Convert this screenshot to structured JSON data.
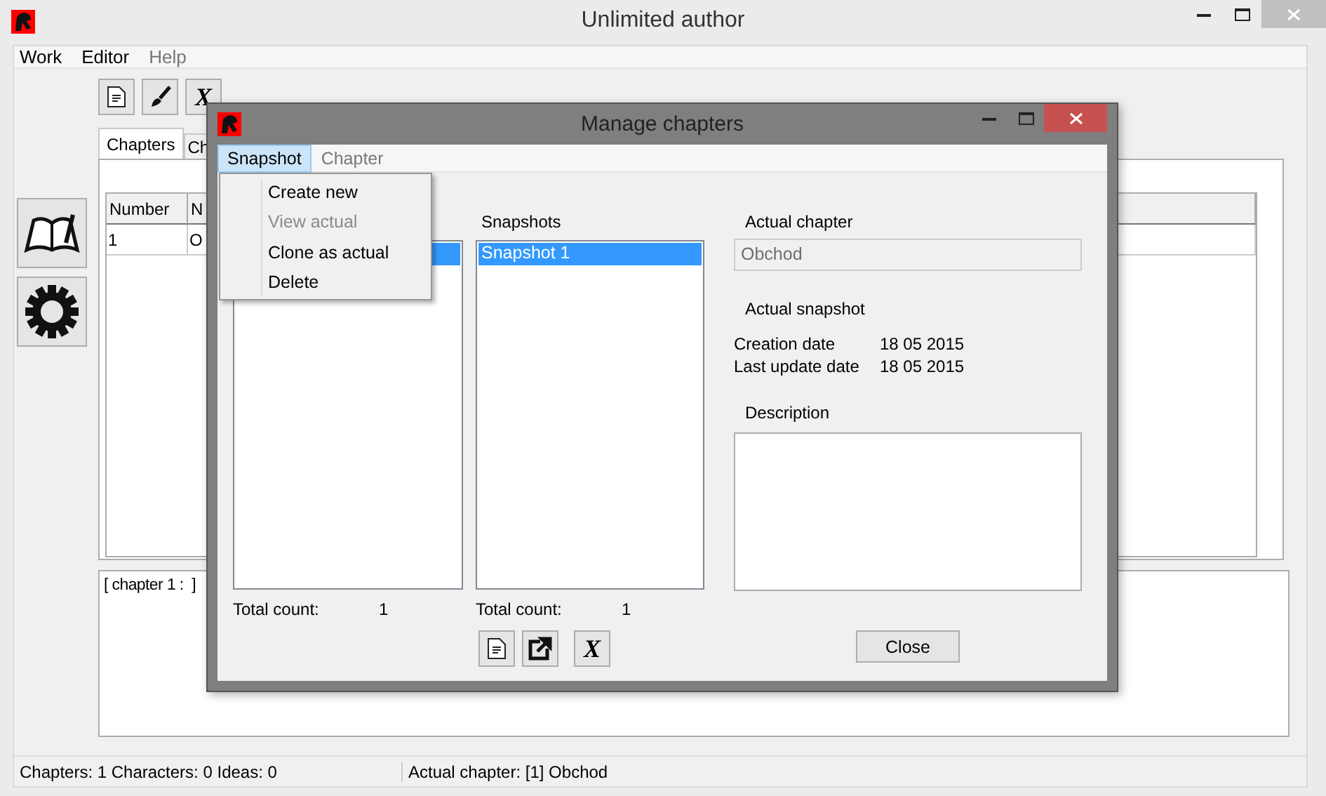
{
  "window": {
    "title": "Unlimited author"
  },
  "menu": [
    {
      "label": "Work",
      "disabled": false
    },
    {
      "label": "Editor",
      "disabled": false
    },
    {
      "label": "Help",
      "disabled": true
    }
  ],
  "toolbar": [
    {
      "kind": "document"
    },
    {
      "kind": "brush"
    },
    {
      "kind": "glyph",
      "text": "X"
    }
  ],
  "side_buttons": [
    {
      "kind": "book"
    },
    {
      "kind": "gear"
    }
  ],
  "tabs": [
    {
      "label": "Chapters",
      "selected": true
    },
    {
      "label": "Ch",
      "selected": false
    }
  ],
  "table": {
    "columns": [
      "Number",
      "N"
    ],
    "rows": [
      [
        "1",
        "O"
      ]
    ]
  },
  "editor": {
    "text": "[ chapter 1 :  ]"
  },
  "status_bar": {
    "counts": "Chapters: 1  Characters: 0  Ideas: 0",
    "actual": "Actual chapter:  [1] Obchod"
  },
  "dialog": {
    "title": "Manage chapters",
    "menu": [
      {
        "label": "Snapshot",
        "selected": true
      },
      {
        "label": "Chapter",
        "selected": false
      }
    ],
    "dropdown": [
      {
        "label": "Create new",
        "disabled": false
      },
      {
        "label": "View actual",
        "disabled": true
      },
      {
        "label": "Clone as actual",
        "disabled": false
      },
      {
        "label": "Delete",
        "disabled": false
      }
    ],
    "chapters_list": {
      "rows": [
        {
          "selected": true
        }
      ],
      "total_label": "Total count:",
      "total": "1"
    },
    "snapshots": {
      "label": "Snapshots",
      "items": [
        {
          "label": "Snapshot 1",
          "selected": true
        }
      ],
      "total_label": "Total count:",
      "total": "1"
    },
    "buttons": [
      {
        "kind": "document"
      },
      {
        "kind": "export"
      },
      {
        "kind": "glyph",
        "text": "X"
      }
    ],
    "actual_chapter": {
      "label": "Actual chapter",
      "value": "Obchod"
    },
    "actual_snapshot": {
      "label": "Actual snapshot",
      "fields": [
        {
          "label": "Creation date",
          "value": "18 05 2015"
        },
        {
          "label": "Last update date",
          "value": "18 05 2015"
        }
      ]
    },
    "description": {
      "label": "Description"
    },
    "close": "Close"
  }
}
